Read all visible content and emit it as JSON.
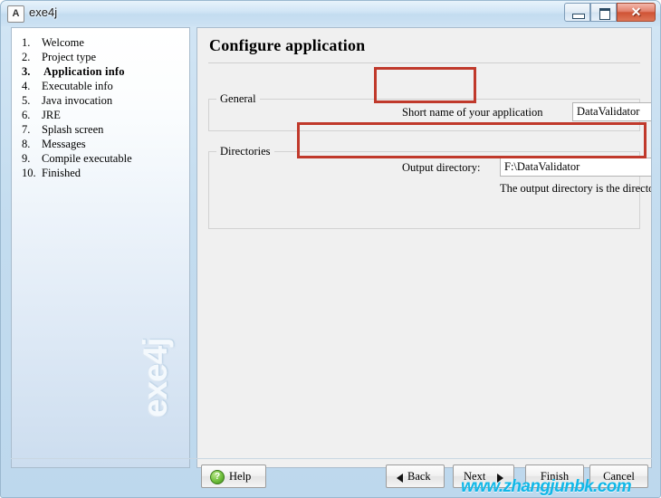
{
  "window": {
    "title": "exe4j",
    "icon": "app-icon",
    "controls": {
      "minimize": "minimize",
      "maximize": "maximize",
      "close": "✕"
    }
  },
  "sidebar": {
    "watermark": "exe4j",
    "steps": [
      {
        "num": "1.",
        "label": "Welcome",
        "active": false
      },
      {
        "num": "2.",
        "label": "Project type",
        "active": false
      },
      {
        "num": "3.",
        "label": "Application info",
        "active": true
      },
      {
        "num": "4.",
        "label": "Executable info",
        "active": false
      },
      {
        "num": "5.",
        "label": "Java invocation",
        "active": false
      },
      {
        "num": "6.",
        "label": "JRE",
        "active": false
      },
      {
        "num": "7.",
        "label": "Splash screen",
        "active": false
      },
      {
        "num": "8.",
        "label": "Messages",
        "active": false
      },
      {
        "num": "9.",
        "label": "Compile executable",
        "active": false
      },
      {
        "num": "10.",
        "label": "Finished",
        "active": false
      }
    ]
  },
  "main": {
    "page_title": "Configure application",
    "general": {
      "group_label": "General",
      "short_name_label": "Short name of your application",
      "short_name_value": "DataValidator",
      "short_name_placeholder": ""
    },
    "directories": {
      "group_label": "Directories",
      "output_dir_label": "Output directory:",
      "output_dir_value": "F:\\DataValidator",
      "output_dir_placeholder": "",
      "browse_label": "...",
      "hint": "The output directory is the directory where the executable will be copied."
    }
  },
  "buttons": {
    "help": "Help",
    "help_icon_glyph": "?",
    "back": "Back",
    "next": "Next",
    "finish": "Finish",
    "cancel": "Cancel"
  },
  "overlay": {
    "site_watermark": "www.zhangjunbk.com",
    "annotation_color": "#c0392b"
  }
}
